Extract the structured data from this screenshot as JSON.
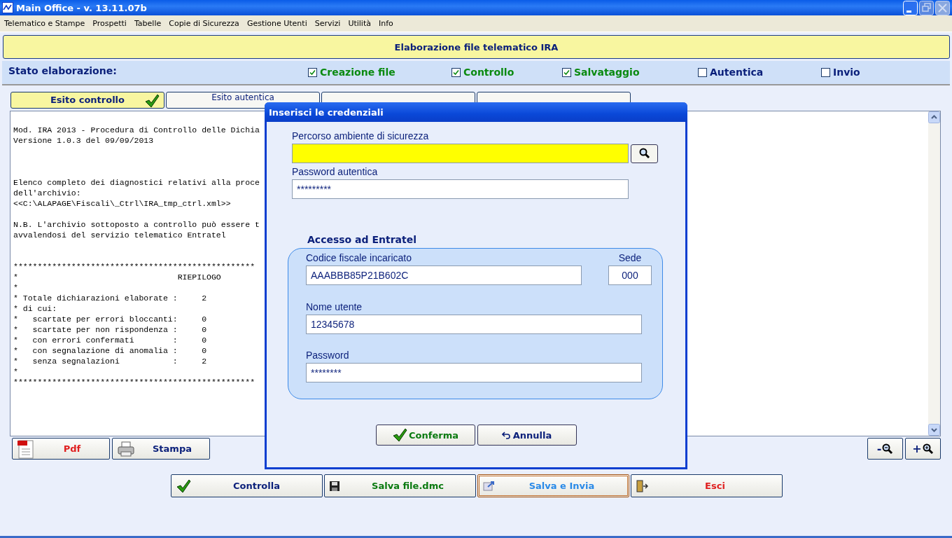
{
  "window": {
    "title": "Main Office - v. 13.11.07b"
  },
  "menu": [
    "Telematico e Stampe",
    "Prospetti",
    "Tabelle",
    "Copie di Sicurezza",
    "Gestione Utenti",
    "Servizi",
    "Utilità",
    "Info"
  ],
  "header": "Elaborazione file telematico IRA",
  "status": {
    "label": "Stato elaborazione:",
    "steps": [
      {
        "label": "Creazione file",
        "checked": true
      },
      {
        "label": "Controllo",
        "checked": true
      },
      {
        "label": "Salvataggio",
        "checked": true
      },
      {
        "label": "Autentica",
        "checked": false
      },
      {
        "label": "Invio",
        "checked": false
      }
    ]
  },
  "tabs": [
    {
      "label": "Esito controllo",
      "selected": true
    },
    {
      "label": "Esito autentica",
      "selected": false
    },
    {
      "selected": false
    },
    {
      "selected": false
    }
  ],
  "report": {
    "blocks": [
      [
        "Mod. IRA 2013 - Procedura di Controllo delle Dichia",
        "Versione 1.0.3 del 09/09/2013"
      ],
      [
        "Elenco completo dei diagnostici relativi alla proce",
        "dell'archivio:",
        "<<C:\\ALAPAGE\\Fiscali\\_Ctrl\\IRA_tmp_ctrl.xml>>"
      ],
      [
        "N.B. L'archivio sottoposto a controllo può essere t",
        "avvalendosi del servizio telematico Entratel"
      ],
      [
        "**************************************************",
        "*                                 RIEPILOGO",
        "*",
        "* Totale dichiarazioni elaborate :     2",
        "* di cui:",
        "*   scartate per errori bloccanti:     0",
        "*   scartate per non rispondenza :     0",
        "*   con errori confermati        :     0",
        "*   con segnalazione di anomalia :     0",
        "*   senza segnalazioni           :     2",
        "*",
        "**************************************************"
      ]
    ]
  },
  "side_buttons": [
    {
      "label": "Pdf",
      "kind": "pdf",
      "color": "#e02020"
    },
    {
      "label": "Stampa",
      "kind": "print",
      "color": "#0a1f7a"
    }
  ],
  "zoom_buttons": [
    {
      "label": "-",
      "kind": "zoom-out"
    },
    {
      "label": "+",
      "kind": "zoom-in"
    }
  ],
  "actions": [
    {
      "label": "Controlla",
      "kind": "check",
      "color": "#0a1f7a",
      "focused": false
    },
    {
      "label": "Salva file.dmc",
      "kind": "save",
      "color": "#0a7a10",
      "focused": false
    },
    {
      "label": "Salva e Invia",
      "kind": "send",
      "color": "#2a8ae8",
      "focused": true
    },
    {
      "label": "Esci",
      "kind": "exit",
      "color": "#e02020",
      "focused": false
    }
  ],
  "dialog": {
    "title": "Inserisci le credenziali",
    "fields": [
      {
        "kind": "path",
        "label": "Percorso ambiente di sicurezza"
      },
      {
        "kind": "text",
        "label": "Password autentica",
        "value": "*********"
      }
    ],
    "group": {
      "title": "Accesso ad Entratel",
      "fields": [
        {
          "kind": "wide",
          "label": "Codice fiscale incaricato",
          "value": "AAABBB85P21B602C"
        },
        {
          "kind": "short",
          "label": "Sede",
          "value": "000"
        },
        {
          "kind": "full",
          "label": "Nome utente",
          "value": "12345678"
        },
        {
          "kind": "full",
          "label": "Password",
          "value": "********"
        }
      ]
    },
    "buttons": [
      {
        "label": "Conferma",
        "kind": "confirm"
      },
      {
        "label": "Annulla",
        "kind": "cancel"
      }
    ]
  }
}
